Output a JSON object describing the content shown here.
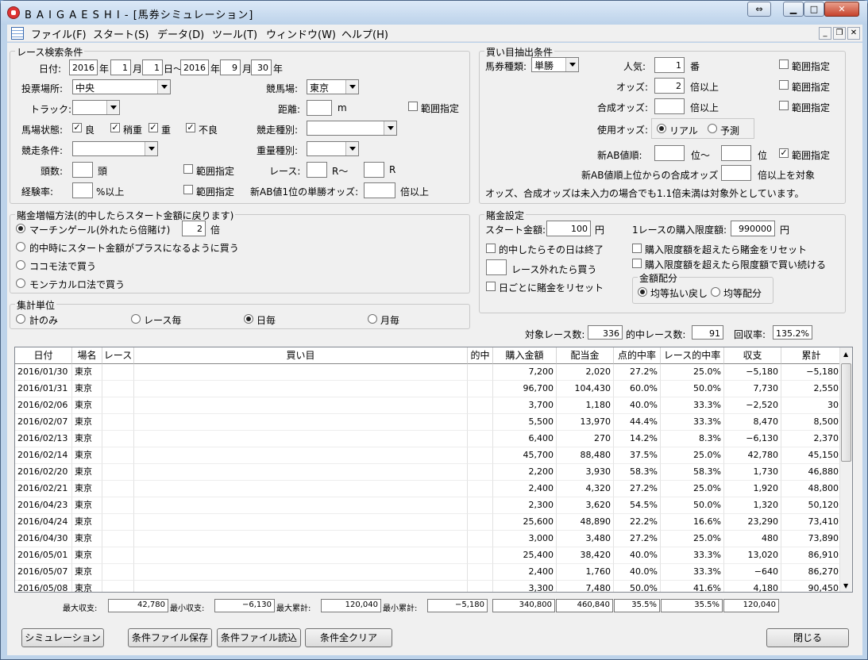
{
  "window": {
    "title": "B A I G A E S H I - [馬券シミュレーション]"
  },
  "menu": [
    "ファイル(F)",
    "スタート(S)",
    "データ(D)",
    "ツール(T)",
    "ウィンドウ(W)",
    "ヘルプ(H)"
  ],
  "race_search": {
    "group_title": "レース検索条件",
    "date_label": "日付:",
    "from_year": "2016",
    "from_month": "1",
    "from_day": "1",
    "to_year": "2016",
    "to_month": "9",
    "to_day": "30",
    "year_u": "年",
    "month_u": "月",
    "day_u": "日",
    "day_tilde": "日〜",
    "venue_label": "投票場所:",
    "venue_value": "中央",
    "track_label": "競馬場:",
    "track_value": "東京",
    "surface_label": "トラック:",
    "distance_label": "距離:",
    "distance_unit": "m",
    "range_label": "範囲指定",
    "condition_label": "馬場状態:",
    "cond_good": "良",
    "cond_sl_heavy": "稍重",
    "cond_heavy": "重",
    "cond_bad": "不良",
    "race_type_label": "競走種別:",
    "race_cond_label": "競走条件:",
    "weight_label": "重量種別:",
    "heads_label": "頭数:",
    "heads_unit": "頭",
    "race_label": "レース:",
    "r_from": "R〜",
    "r_unit": "R",
    "exp_label": "経験率:",
    "exp_unit": "%以上",
    "ab_label": "新AB値1位の単勝オッズ:",
    "ab_unit": "倍以上"
  },
  "bet_extract": {
    "group_title": "買い目抽出条件",
    "type_label": "馬券種類:",
    "type_value": "単勝",
    "pop_label": "人気:",
    "pop_value": "1",
    "pop_unit": "番",
    "range_label": "範囲指定",
    "odds_label": "オッズ:",
    "odds_value": "2",
    "odds_unit": "倍以上",
    "combo_label": "合成オッズ:",
    "combo_unit": "倍以上",
    "use_odds_label": "使用オッズ:",
    "real": "リアル",
    "forecast": "予測",
    "ab_order_label": "新AB値順:",
    "ab_order_mid": "位〜",
    "ab_order_end": "位",
    "ab_combo_label": "新AB値順上位からの合成オッズ",
    "ab_combo_unit": "倍以上を対象",
    "note": "オッズ、合成オッズは未入力の場合でも1.1倍未満は対象外としています。"
  },
  "increase": {
    "group_title": "賭金増幅方法(的中したらスタート金額に戻ります)",
    "opt1": "マーチンゲール(外れたら倍賭け)",
    "opt1_value": "2",
    "opt1_unit": "倍",
    "opt2": "的中時にスタート金額がプラスになるように買う",
    "opt3": "ココモ法で買う",
    "opt4": "モンテカルロ法で買う"
  },
  "bet_settings": {
    "group_title": "賭金設定",
    "start_label": "スタート金額:",
    "start_value": "100",
    "yen": "円",
    "limit_label": "1レースの購入限度額:",
    "limit_value": "990000",
    "stop_day": "的中したらその日は終了",
    "reset_over": "購入限度額を超えたら賭金をリセット",
    "buy_after": "レース外れたら買う",
    "keep_limit": "購入限度額を超えたら限度額で買い続ける",
    "reset_day": "日ごとに賭金をリセット",
    "alloc_title": "金額配分",
    "alloc_equal_pay": "均等払い戻し",
    "alloc_equal": "均等配分"
  },
  "unit": {
    "group_title": "集計単位",
    "total": "計のみ",
    "race": "レース毎",
    "day": "日毎",
    "month": "月毎"
  },
  "stats": {
    "target_label": "対象レース数:",
    "target": "336",
    "hit_label": "的中レース数:",
    "hit": "91",
    "recovery_label": "回収率:",
    "recovery": "135.2%"
  },
  "table": {
    "headers": [
      "日付",
      "場名",
      "レース",
      "買い目",
      "的中",
      "購入金額",
      "配当金",
      "点的中率",
      "レース的中率",
      "収支",
      "累計"
    ],
    "rows": [
      [
        "2016/01/30",
        "東京",
        "",
        "",
        "",
        "7,200",
        "2,020",
        "27.2%",
        "25.0%",
        "−5,180",
        "−5,180"
      ],
      [
        "2016/01/31",
        "東京",
        "",
        "",
        "",
        "96,700",
        "104,430",
        "60.0%",
        "50.0%",
        "7,730",
        "2,550"
      ],
      [
        "2016/02/06",
        "東京",
        "",
        "",
        "",
        "3,700",
        "1,180",
        "40.0%",
        "33.3%",
        "−2,520",
        "30"
      ],
      [
        "2016/02/07",
        "東京",
        "",
        "",
        "",
        "5,500",
        "13,970",
        "44.4%",
        "33.3%",
        "8,470",
        "8,500"
      ],
      [
        "2016/02/13",
        "東京",
        "",
        "",
        "",
        "6,400",
        "270",
        "14.2%",
        "8.3%",
        "−6,130",
        "2,370"
      ],
      [
        "2016/02/14",
        "東京",
        "",
        "",
        "",
        "45,700",
        "88,480",
        "37.5%",
        "25.0%",
        "42,780",
        "45,150"
      ],
      [
        "2016/02/20",
        "東京",
        "",
        "",
        "",
        "2,200",
        "3,930",
        "58.3%",
        "58.3%",
        "1,730",
        "46,880"
      ],
      [
        "2016/02/21",
        "東京",
        "",
        "",
        "",
        "2,400",
        "4,320",
        "27.2%",
        "25.0%",
        "1,920",
        "48,800"
      ],
      [
        "2016/04/23",
        "東京",
        "",
        "",
        "",
        "2,300",
        "3,620",
        "54.5%",
        "50.0%",
        "1,320",
        "50,120"
      ],
      [
        "2016/04/24",
        "東京",
        "",
        "",
        "",
        "25,600",
        "48,890",
        "22.2%",
        "16.6%",
        "23,290",
        "73,410"
      ],
      [
        "2016/04/30",
        "東京",
        "",
        "",
        "",
        "3,000",
        "3,480",
        "27.2%",
        "25.0%",
        "480",
        "73,890"
      ],
      [
        "2016/05/01",
        "東京",
        "",
        "",
        "",
        "25,400",
        "38,420",
        "40.0%",
        "33.3%",
        "13,020",
        "86,910"
      ],
      [
        "2016/05/07",
        "東京",
        "",
        "",
        "",
        "2,400",
        "1,760",
        "40.0%",
        "33.3%",
        "−640",
        "86,270"
      ],
      [
        "2016/05/08",
        "東京",
        "",
        "",
        "",
        "3,300",
        "7,480",
        "50.0%",
        "41.6%",
        "4,180",
        "90,450"
      ]
    ]
  },
  "summary": {
    "max_label": "最大収支:",
    "max": "42,780",
    "min_label": "最小収支:",
    "min": "−6,130",
    "maxcum_label": "最大累計:",
    "maxcum": "120,040",
    "mincum_label": "最小累計:",
    "mincum": "−5,180",
    "buy_total": "340,800",
    "pay_total": "460,840",
    "point_rate": "35.5%",
    "race_rate": "35.5%",
    "balance": "120,040"
  },
  "buttons": {
    "simulate": "シミュレーション",
    "save": "条件ファイル保存",
    "load": "条件ファイル読込",
    "clear": "条件全クリア",
    "close": "閉じる"
  }
}
